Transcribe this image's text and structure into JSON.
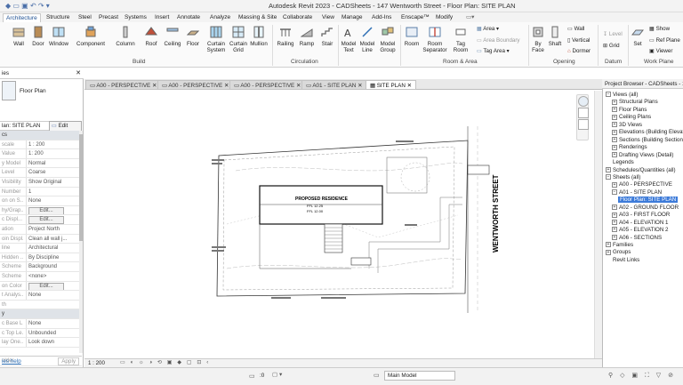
{
  "window": {
    "title": "Autodesk Revit 2023 - CADSheets - 147 Wentworth Street - Floor Plan: SITE PLAN"
  },
  "ribbon_tabs": [
    "Architecture",
    "Structure",
    "Steel",
    "Precast",
    "Systems",
    "Insert",
    "Annotate",
    "Analyze",
    "Massing & Site",
    "Collaborate",
    "View",
    "Manage",
    "Add-Ins",
    "Enscape™",
    "Modify"
  ],
  "ribbon": {
    "build": [
      "Wall",
      "Door",
      "Window",
      "Component",
      "Column",
      "Roof",
      "Ceiling",
      "Floor",
      "Curtain System",
      "Curtain Grid",
      "Mullion"
    ],
    "circulation": [
      "Railing",
      "Ramp",
      "Stair"
    ],
    "model": [
      "Model Text",
      "Model Line",
      "Model Group"
    ],
    "room_area": [
      "Room",
      "Room Separator",
      "Tag Room"
    ],
    "room_area_small": [
      "Area",
      "Area Boundary",
      "Tag Area"
    ],
    "opening": [
      "By Face",
      "Shaft",
      "Wall",
      "Vertical",
      "Dormer"
    ],
    "datum": [
      "Level",
      "Grid"
    ],
    "work_plane": [
      "Set",
      "Show",
      "Ref Plane",
      "Viewer"
    ],
    "panel_titles": {
      "build": "Build",
      "circulation": "Circulation",
      "room_area": "Room & Area",
      "opening": "Opening",
      "datum": "Datum",
      "work_plane": "Work Plane"
    }
  },
  "properties": {
    "title": "ies",
    "type_name": "Floor Plan",
    "selector": "lan: SITE PLAN",
    "edit_type": "Edit Type",
    "rows": [
      {
        "k": "cs",
        "v": "",
        "sect": true
      },
      {
        "k": "scale",
        "v": "1 : 200"
      },
      {
        "k": "Value",
        "v": "1: 200"
      },
      {
        "k": "y Model",
        "v": "Normal"
      },
      {
        "k": "Level",
        "v": "Coarse"
      },
      {
        "k": "Visibility",
        "v": "Show Original"
      },
      {
        "k": "Number",
        "v": "1"
      },
      {
        "k": "on on S...",
        "v": "None"
      },
      {
        "k": "hy/Grap...",
        "v": "Edit..."
      },
      {
        "k": "c Displ...",
        "v": "Edit..."
      },
      {
        "k": "ation",
        "v": "Project North"
      },
      {
        "k": "oin Displ...",
        "v": "Clean all wall j..."
      },
      {
        "k": "line",
        "v": "Architectural"
      },
      {
        "k": "Hidden ...",
        "v": "By Discipline"
      },
      {
        "k": "Scheme ...",
        "v": "Background"
      },
      {
        "k": "Scheme",
        "v": "<none>"
      },
      {
        "k": "on Color ...",
        "v": "Edit..."
      },
      {
        "k": "t Analys...",
        "v": "None"
      },
      {
        "k": "th",
        "v": ""
      },
      {
        "k": "y",
        "v": "",
        "sect": true
      },
      {
        "k": "c Base L...",
        "v": "None"
      },
      {
        "k": "c Top Le...",
        "v": "Unbounded"
      },
      {
        "k": "lay One...",
        "v": "Look down"
      },
      {
        "k": "",
        "v": ""
      },
      {
        "k": "older",
        "v": ""
      }
    ],
    "help": "ies help",
    "apply": "Apply"
  },
  "view_tabs": [
    "A00 - PERSPECTIVE",
    "A00 - PERSPECTIVE",
    "A00 - PERSPECTIVE",
    "A01 - SITE PLAN",
    "SITE PLAN"
  ],
  "drawing": {
    "street": "WENTWORTH STREET",
    "residence": "PROPOSED RESIDENCE",
    "ffl1": "FFL 12.25",
    "ffl2": "FFL 12.00"
  },
  "view_scale": "1 : 200",
  "browser": {
    "title": "Project Browser - CADSheets - 147 Wentworth Street",
    "items": [
      {
        "t": "Views (all)",
        "lvl": 0,
        "tog": "-"
      },
      {
        "t": "Structural Plans",
        "lvl": 1,
        "tog": "+"
      },
      {
        "t": "Floor Plans",
        "lvl": 1,
        "tog": "+"
      },
      {
        "t": "Ceiling Plans",
        "lvl": 1,
        "tog": "+"
      },
      {
        "t": "3D Views",
        "lvl": 1,
        "tog": "+"
      },
      {
        "t": "Elevations (Building Elevation)",
        "lvl": 1,
        "tog": "+"
      },
      {
        "t": "Sections (Building Section)",
        "lvl": 1,
        "tog": "+"
      },
      {
        "t": "Renderings",
        "lvl": 1,
        "tog": "+"
      },
      {
        "t": "Drafting Views (Detail)",
        "lvl": 1,
        "tog": "+"
      },
      {
        "t": "Legends",
        "lvl": 0,
        "tog": ""
      },
      {
        "t": "Schedules/Quantities (all)",
        "lvl": 0,
        "tog": "+"
      },
      {
        "t": "Sheets (all)",
        "lvl": 0,
        "tog": "-"
      },
      {
        "t": "A00 - PERSPECTIVE",
        "lvl": 1,
        "tog": "+"
      },
      {
        "t": "A01 - SITE PLAN",
        "lvl": 1,
        "tog": "-"
      },
      {
        "t": "Floor Plan: SITE PLAN",
        "lvl": 2,
        "tog": "",
        "sel": true
      },
      {
        "t": "A02 - GROUND FLOOR",
        "lvl": 1,
        "tog": "+"
      },
      {
        "t": "A03 - FIRST FLOOR",
        "lvl": 1,
        "tog": "+"
      },
      {
        "t": "A04 - ELEVATION 1",
        "lvl": 1,
        "tog": "+"
      },
      {
        "t": "A05 - ELEVATION 2",
        "lvl": 1,
        "tog": "+"
      },
      {
        "t": "A06 - SECTIONS",
        "lvl": 1,
        "tog": "+"
      },
      {
        "t": "Families",
        "lvl": 0,
        "tog": "+"
      },
      {
        "t": "Groups",
        "lvl": 0,
        "tog": "+"
      },
      {
        "t": "Revit Links",
        "lvl": 0,
        "tog": ""
      }
    ]
  },
  "status": {
    "zero": ":0",
    "model": "Main Model"
  }
}
